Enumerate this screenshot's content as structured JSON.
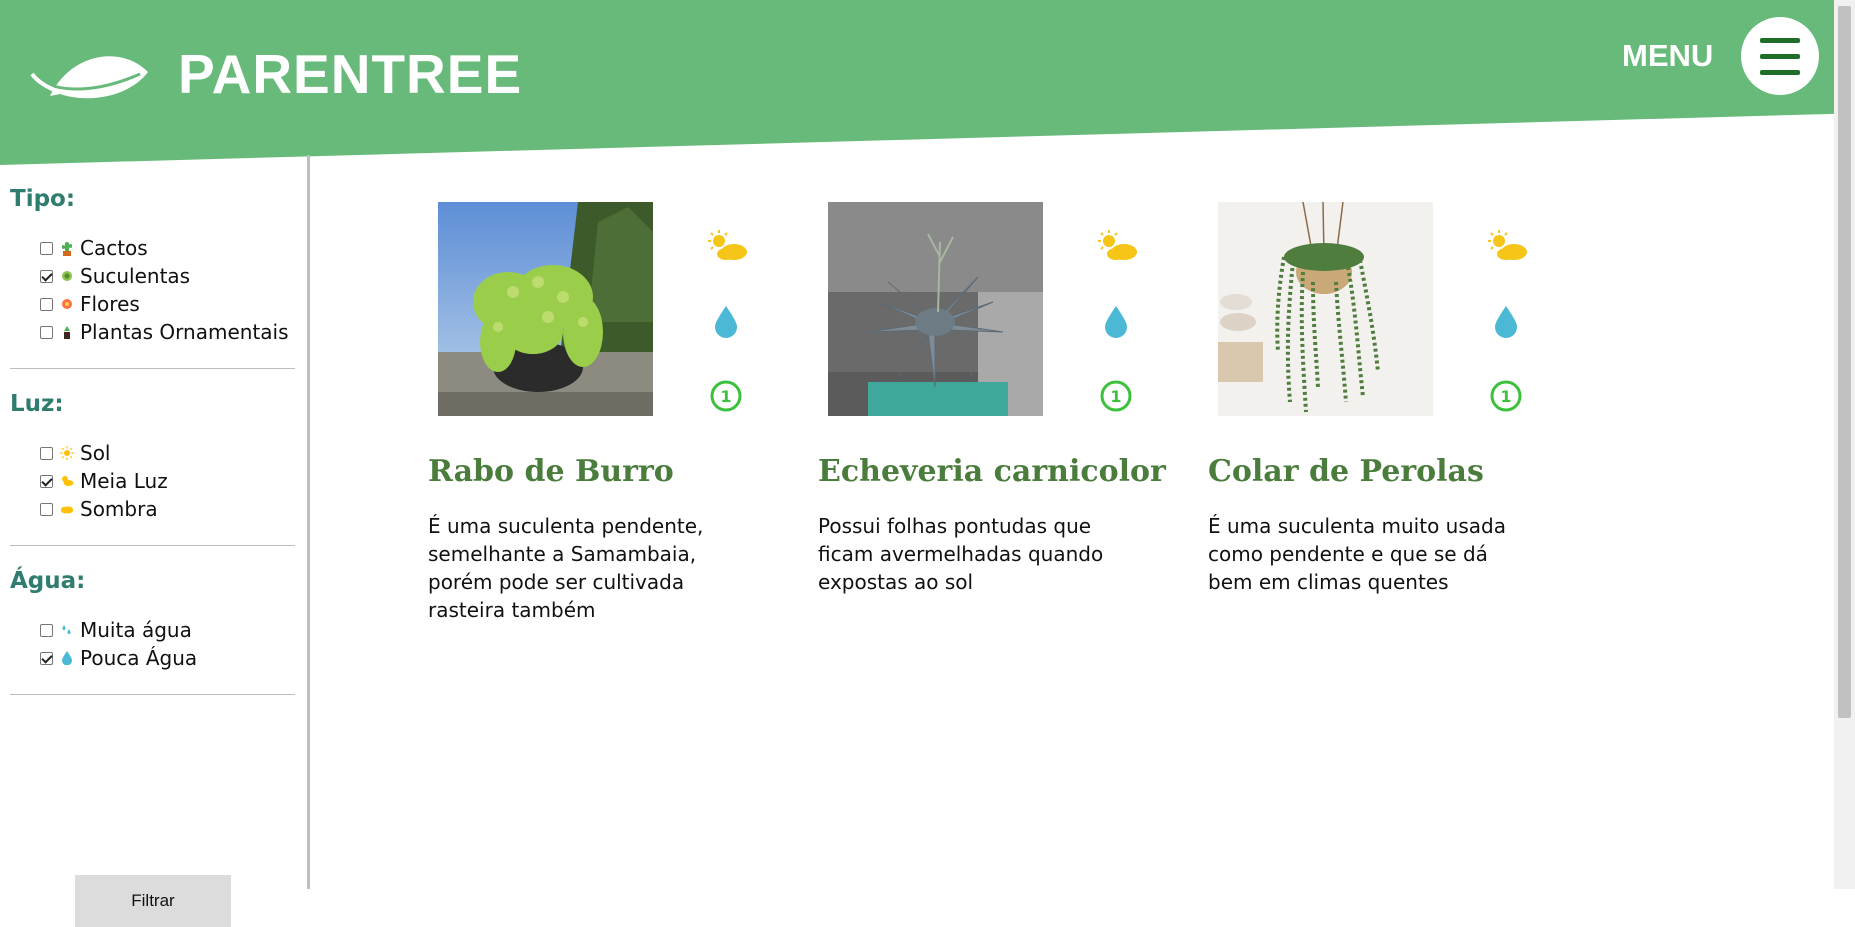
{
  "brand": {
    "name": "PARENTREE",
    "logo_icon": "leaf-icon"
  },
  "header": {
    "menu_label": "MENU",
    "menu_icon": "hamburger-icon",
    "bg_color": "#68ba7b"
  },
  "sidebar": {
    "groups": [
      {
        "title": "Tipo:",
        "options": [
          {
            "label": "Cactos",
            "icon": "cactus-icon",
            "checked": false
          },
          {
            "label": "Suculentas",
            "icon": "succulent-icon",
            "checked": true
          },
          {
            "label": "Flores",
            "icon": "flower-icon",
            "checked": false
          },
          {
            "label": "Plantas Ornamentais",
            "icon": "potted-plant-icon",
            "checked": false
          }
        ]
      },
      {
        "title": "Luz:",
        "options": [
          {
            "label": "Sol",
            "icon": "sun-icon",
            "checked": false
          },
          {
            "label": "Meia Luz",
            "icon": "sun-cloud-icon",
            "checked": true
          },
          {
            "label": "Sombra",
            "icon": "cloud-icon",
            "checked": false
          }
        ]
      },
      {
        "title": "Água:",
        "options": [
          {
            "label": "Muita água",
            "icon": "water-drops-icon",
            "checked": false
          },
          {
            "label": "Pouca Água",
            "icon": "water-drop-icon",
            "checked": true
          }
        ]
      }
    ],
    "filter_label": "Filtrar"
  },
  "cards": [
    {
      "title": "Rabo de Burro",
      "description": "É uma suculenta pendente, semelhante a Samambaia, porém pode ser cultivada rasteira também",
      "light_icon": "sun-cloud-icon",
      "water_icon": "water-drop-icon",
      "level": "1"
    },
    {
      "title": "Echeveria carnicolor",
      "description": "Possui folhas pontudas que ficam avermelhadas quando expostas ao sol",
      "light_icon": "sun-cloud-icon",
      "water_icon": "water-drop-icon",
      "level": "1"
    },
    {
      "title": "Colar de Perolas",
      "description": "É uma suculenta muito usada como pendente e que se dá bem em climas quentes",
      "light_icon": "sun-cloud-icon",
      "water_icon": "water-drop-icon",
      "level": "1"
    }
  ]
}
